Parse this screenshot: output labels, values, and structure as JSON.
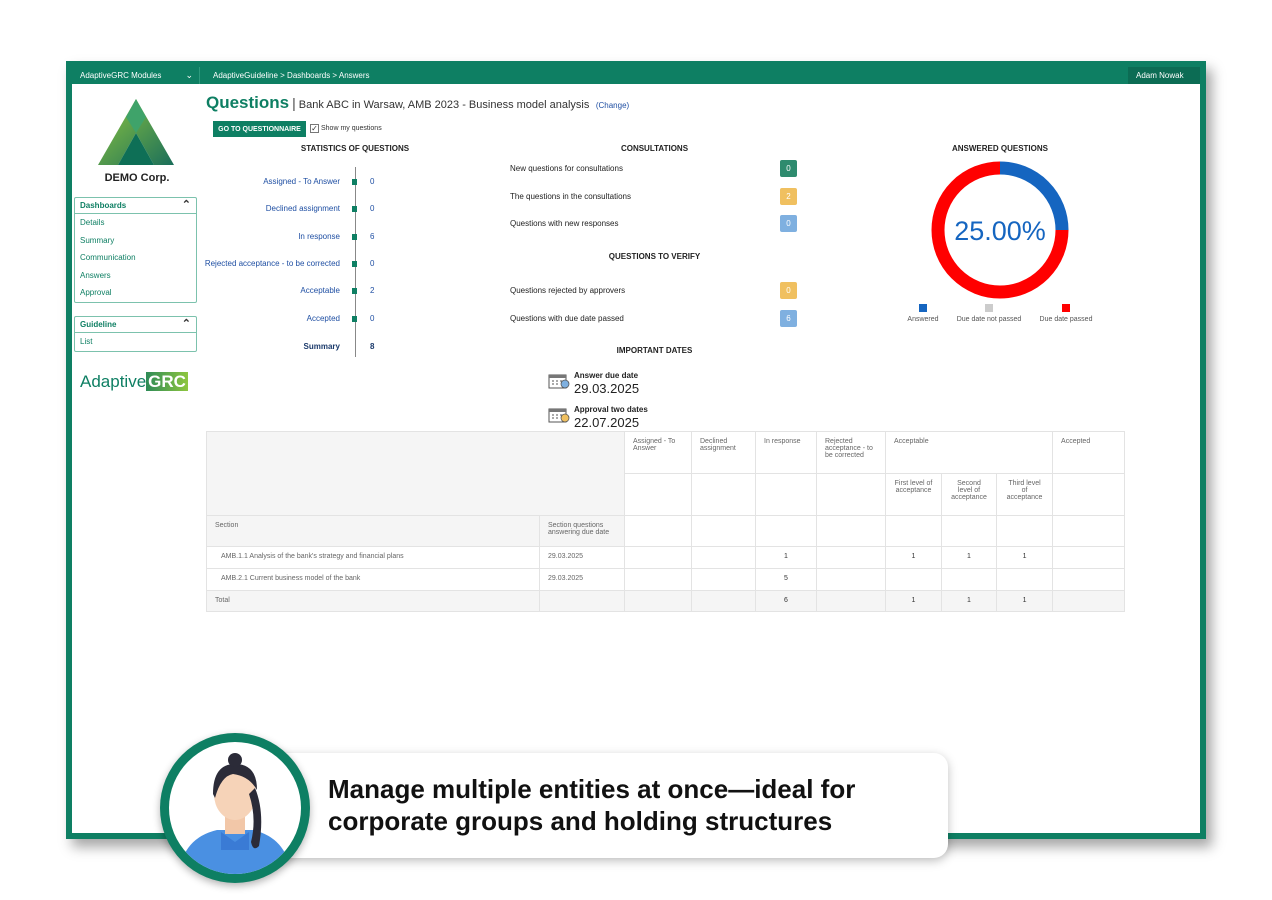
{
  "topbar": {
    "modules": "AdaptiveGRC Modules",
    "breadcrumb": "AdaptiveGuideline > Dashboards > Answers",
    "user": "Adam Nowak"
  },
  "sidebar": {
    "company": "DEMO Corp.",
    "dashboards": {
      "title": "Dashboards",
      "items": [
        "Details",
        "Summary",
        "Communication",
        "Answers",
        "Approval"
      ]
    },
    "guideline": {
      "title": "Guideline",
      "items": [
        "List"
      ]
    },
    "brand": {
      "prefix": "Adaptive",
      "suffix": "GRC"
    }
  },
  "header": {
    "title": "Questions",
    "separator": "|",
    "subtitle": "Bank ABC in Warsaw, AMB 2023 - Business model analysis",
    "change": "(Change)"
  },
  "actions": {
    "go_questionnaire": "GO TO QUESTIONNAIRE",
    "show_my_questions": "Show my questions",
    "show_my_checked": true
  },
  "statistics": {
    "title": "STATISTICS OF QUESTIONS",
    "rows": [
      {
        "label": "Assigned - To Answer",
        "value": "0"
      },
      {
        "label": "Declined assignment",
        "value": "0"
      },
      {
        "label": "In response",
        "value": "6"
      },
      {
        "label": "Rejected acceptance - to be corrected",
        "value": "0"
      },
      {
        "label": "Acceptable",
        "value": "2"
      },
      {
        "label": "Accepted",
        "value": "0"
      },
      {
        "label": "Summary",
        "value": "8"
      }
    ]
  },
  "consultations": {
    "title": "CONSULTATIONS",
    "rows": [
      {
        "label": "New questions for consultations",
        "value": "0",
        "color": "#2e8b6e"
      },
      {
        "label": "The questions in the consultations",
        "value": "2",
        "color": "#f0c060"
      },
      {
        "label": "Questions with new responses",
        "value": "0",
        "color": "#7fb0e0"
      }
    ]
  },
  "verify": {
    "title": "QUESTIONS TO VERIFY",
    "rows": [
      {
        "label": "Questions rejected by approvers",
        "value": "0",
        "color": "#f0c060"
      },
      {
        "label": "Questions with due date passed",
        "value": "6",
        "color": "#7fb0e0"
      }
    ]
  },
  "dates": {
    "title": "IMPORTANT DATES",
    "rows": [
      {
        "label": "Answer due date",
        "value": "29.03.2025"
      },
      {
        "label": "Approval two dates",
        "value": "22.07.2025"
      }
    ]
  },
  "answered": {
    "title": "ANSWERED QUESTIONS",
    "percent_label": "25.00%",
    "segments": [
      {
        "name": "Answered",
        "value": 25,
        "color": "#1565c0"
      },
      {
        "name": "Due date not passed",
        "value": 0,
        "color": "#cccccc"
      },
      {
        "name": "Due date passed",
        "value": 75,
        "color": "#ff0000"
      }
    ]
  },
  "table": {
    "headers": [
      "Assigned - To Answer",
      "Declined assignment",
      "In response",
      "Rejected acceptance - to be corrected",
      "Acceptable",
      "Accepted"
    ],
    "subheaders": [
      "First level of acceptance",
      "Second level of acceptance",
      "Third level of acceptance"
    ],
    "col_section": "Section",
    "col_due": "Section questions answering due date",
    "rows": [
      {
        "section": "AMB.1.1 Analysis of the bank's strategy and financial plans",
        "due": "29.03.2025",
        "in_response": "1",
        "first": "1",
        "second": "1",
        "third": "1"
      },
      {
        "section": "AMB.2.1 Current business model of the bank",
        "due": "29.03.2025",
        "in_response": "5",
        "first": "",
        "second": "",
        "third": ""
      }
    ],
    "total": {
      "label": "Total",
      "in_response": "6",
      "first": "1",
      "second": "1",
      "third": "1"
    }
  },
  "caption": "Manage multiple entities at once—ideal for corporate groups and holding structures"
}
